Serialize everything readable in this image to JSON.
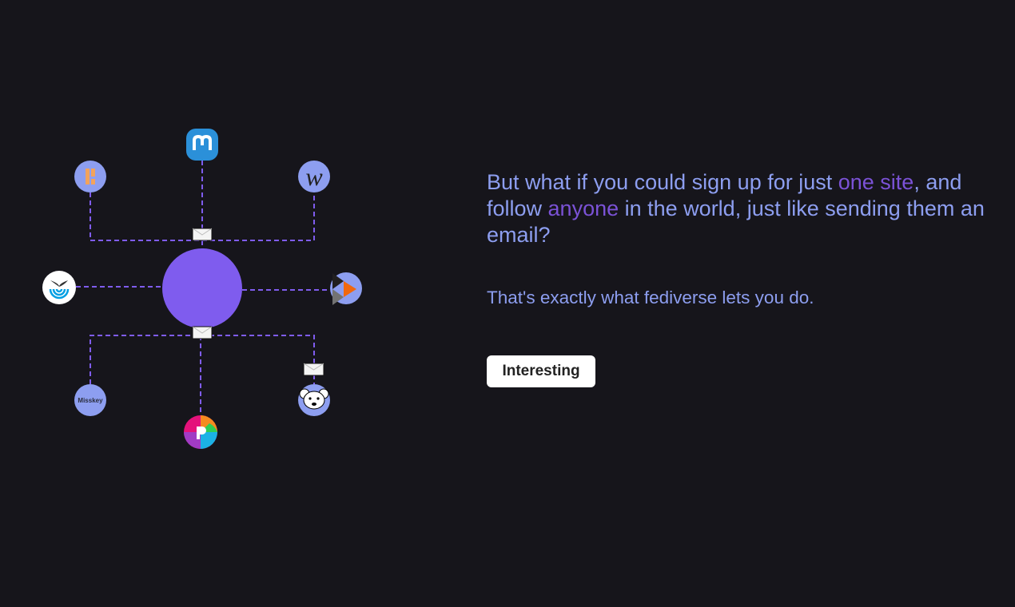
{
  "headline": {
    "part1": "But what if you could sign up for just ",
    "highlight1": "one site",
    "part2": ", and follow ",
    "highlight2": "anyone",
    "part3": " in the world, just like sending them an email?"
  },
  "subtext": "That's exactly what fediverse lets you do.",
  "button_label": "Interesting",
  "diagram": {
    "misskey_label": "Misskey",
    "colors": {
      "hub": "#7f5cee",
      "line": "#7f5cee",
      "node": "#8d9ef0",
      "text": "#8d9ef0",
      "highlight": "#7b52d6"
    }
  }
}
